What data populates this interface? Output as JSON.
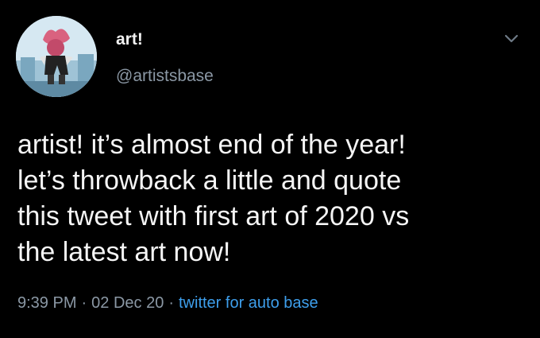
{
  "author": {
    "name": "art!",
    "handle": "@artistsbase",
    "avatar_icon": "character-avatar-icon"
  },
  "tweet": {
    "lines": [
      "artist! it’s almost end of the year!",
      "let’s throwback a little and quote",
      "this tweet with first art of 2020 vs",
      "the latest art now!"
    ],
    "time": "9:39 PM",
    "date": "02 Dec 20",
    "separator": "·",
    "source": "twitter for auto base"
  },
  "icons": {
    "menu": "chevron-down-icon"
  },
  "colors": {
    "background": "#000000",
    "text": "#f5f5f5",
    "secondary": "#8b98a5",
    "link": "#3e9fec"
  }
}
